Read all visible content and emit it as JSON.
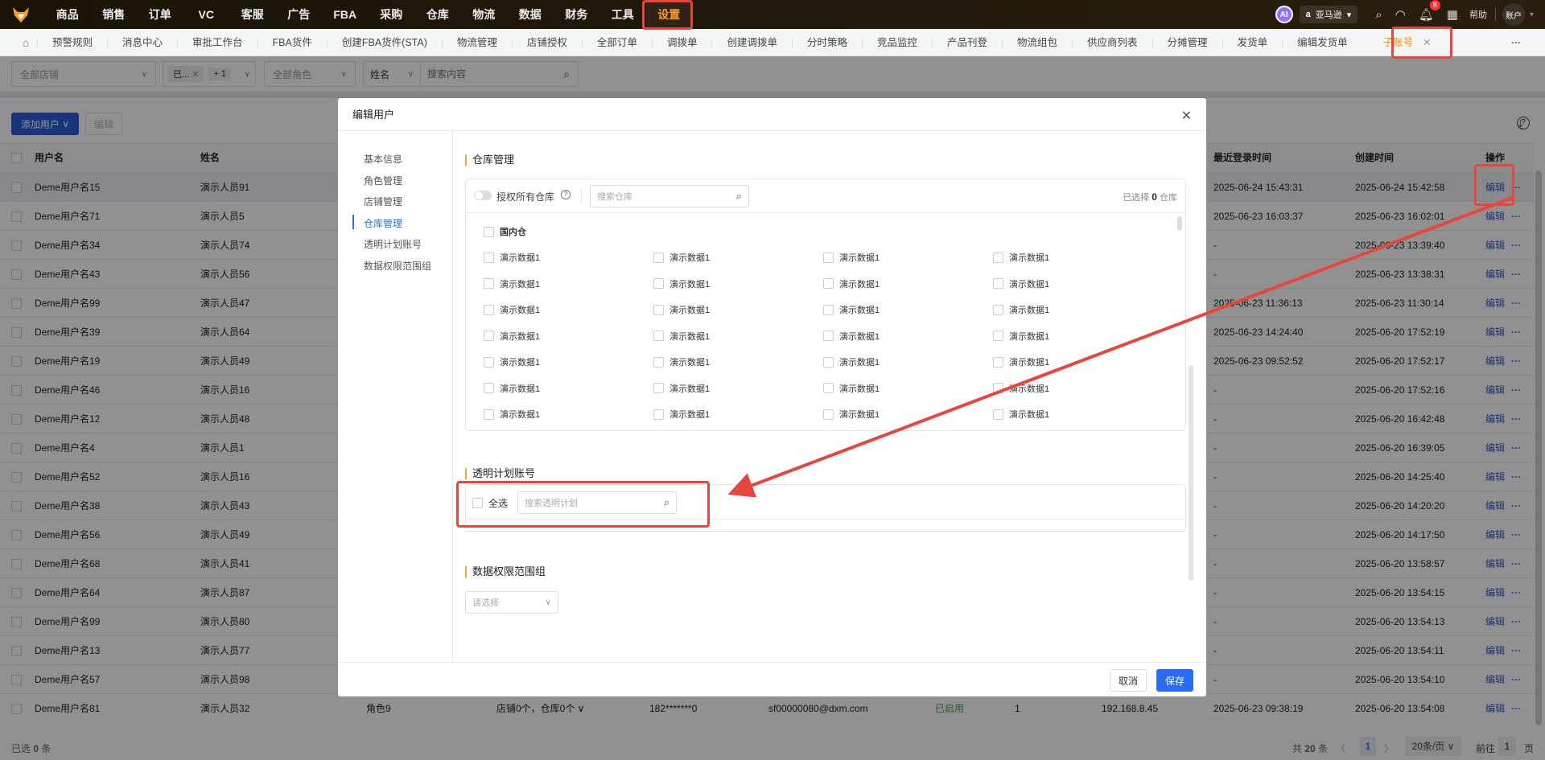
{
  "topnav": {
    "items": [
      "商品",
      "销售",
      "订单",
      "VC",
      "客服",
      "广告",
      "FBA",
      "采购",
      "仓库",
      "物流",
      "数据",
      "财务",
      "工具",
      "设置"
    ],
    "active": "设置",
    "ai": "AI",
    "platform": "亚马逊",
    "notifications": "8",
    "help": "帮助",
    "account": "账户"
  },
  "tabs": {
    "items": [
      "预警规则",
      "消息中心",
      "审批工作台",
      "FBA货件",
      "创建FBA货件(STA)",
      "物流管理",
      "店铺授权",
      "全部订单",
      "调拨单",
      "创建调拨单",
      "分时策略",
      "竞品监控",
      "产品刊登",
      "物流组包",
      "供应商列表",
      "分摊管理",
      "发货单",
      "编辑发货单"
    ],
    "active": "子账号",
    "more": "···"
  },
  "filters": {
    "store": "全部店铺",
    "status_chip": "已...",
    "status_more": "+ 1",
    "role": "全部角色",
    "field": "姓名",
    "search_placeholder": "搜索内容"
  },
  "toolbar": {
    "add_user": "添加用户",
    "edit": "编辑"
  },
  "table": {
    "headers": {
      "username": "用户名",
      "name": "姓名",
      "last_login": "最近登录时间",
      "created": "创建时间",
      "actions": "操作"
    },
    "edit_label": "编辑",
    "more_label": "···",
    "rows": [
      {
        "username": "Deme用户名15",
        "name": "演示人员91",
        "last_login": "2025-06-24 15:43:31",
        "created": "2025-06-24 15:42:58"
      },
      {
        "username": "Deme用户名71",
        "name": "演示人员5",
        "last_login": "2025-06-23 16:03:37",
        "created": "2025-06-23 16:02:01"
      },
      {
        "username": "Deme用户名34",
        "name": "演示人员74",
        "last_login": "-",
        "created": "2025-06-23 13:39:40"
      },
      {
        "username": "Deme用户名43",
        "name": "演示人员56",
        "last_login": "-",
        "created": "2025-06-23 13:38:31"
      },
      {
        "username": "Deme用户名99",
        "name": "演示人员47",
        "last_login": "2025-06-23 11:36:13",
        "created": "2025-06-23 11:30:14"
      },
      {
        "username": "Deme用户名39",
        "name": "演示人员64",
        "last_login": "2025-06-23 14:24:40",
        "created": "2025-06-20 17:52:19"
      },
      {
        "username": "Deme用户名19",
        "name": "演示人员49",
        "last_login": "2025-06-23 09:52:52",
        "created": "2025-06-20 17:52:17"
      },
      {
        "username": "Deme用户名46",
        "name": "演示人员16",
        "last_login": "-",
        "created": "2025-06-20 17:52:16"
      },
      {
        "username": "Deme用户名12",
        "name": "演示人员48",
        "last_login": "-",
        "created": "2025-06-20 16:42:48"
      },
      {
        "username": "Deme用户名4",
        "name": "演示人员1",
        "last_login": "-",
        "created": "2025-06-20 16:39:05"
      },
      {
        "username": "Deme用户名52",
        "name": "演示人员16",
        "last_login": "-",
        "created": "2025-06-20 14:25:40"
      },
      {
        "username": "Deme用户名38",
        "name": "演示人员43",
        "last_login": "-",
        "created": "2025-06-20 14:20:20"
      },
      {
        "username": "Deme用户名56",
        "name": "演示人员49",
        "last_login": "-",
        "created": "2025-06-20 14:17:50"
      },
      {
        "username": "Deme用户名68",
        "name": "演示人员41",
        "last_login": "-",
        "created": "2025-06-20 13:58:57"
      },
      {
        "username": "Deme用户名64",
        "name": "演示人员87",
        "last_login": "-",
        "created": "2025-06-20 13:54:15"
      },
      {
        "username": "Deme用户名99",
        "name": "演示人员80",
        "last_login": "-",
        "created": "2025-06-20 13:54:13"
      },
      {
        "username": "Deme用户名13",
        "name": "演示人员77",
        "last_login": "-",
        "created": "2025-06-20 13:54:11"
      },
      {
        "username": "Deme用户名57",
        "name": "演示人员98",
        "last_login": "-",
        "created": "2025-06-20 13:54:10"
      },
      {
        "username": "Deme用户名81",
        "name": "演示人员32",
        "role": "角色9",
        "scope": "店铺0个，仓库0个 ∨",
        "phone": "182*******0",
        "email": "sf00000080@dxm.com",
        "status": "已启用",
        "count": "1",
        "ip": "192.168.8.45",
        "last_login": "2025-06-23 09:38:19",
        "created": "2025-06-20 13:54:08"
      }
    ]
  },
  "footer": {
    "selected_prefix": "已选",
    "selected": "0",
    "selected_suffix": "条",
    "total_prefix": "共",
    "total": "20",
    "total_suffix": "条",
    "page": "1",
    "page_size": "20条/页",
    "goto": "前往",
    "goto_page": "1",
    "page_suffix": "页"
  },
  "modal": {
    "title": "编辑用户",
    "nav": [
      "基本信息",
      "角色管理",
      "店铺管理",
      "仓库管理",
      "透明计划账号",
      "数据权限范围组"
    ],
    "warehouse": {
      "title": "仓库管理",
      "authorize_all": "授权所有仓库",
      "search_placeholder": "搜索仓库",
      "selected_prefix": "已选择",
      "selected_count": "0",
      "selected_suffix": "仓库",
      "group": "国内仓",
      "items": [
        "演示数据1",
        "演示数据1",
        "演示数据1",
        "演示数据1",
        "演示数据1",
        "演示数据1",
        "演示数据1",
        "演示数据1",
        "演示数据1",
        "演示数据1",
        "演示数据1",
        "演示数据1",
        "演示数据1",
        "演示数据1",
        "演示数据1",
        "演示数据1",
        "演示数据1",
        "演示数据1",
        "演示数据1",
        "演示数据1",
        "演示数据1",
        "演示数据1",
        "演示数据1",
        "演示数据1",
        "演示数据1",
        "演示数据1",
        "演示数据1",
        "演示数据1"
      ]
    },
    "transparency": {
      "title": "透明计划账号",
      "select_all": "全选",
      "search_placeholder": "搜索透明计划"
    },
    "scope": {
      "title": "数据权限范围组",
      "placeholder": "请选择"
    },
    "cancel": "取消",
    "save": "保存"
  },
  "colors": {
    "accent": "#ff9a2e",
    "primary": "#2b6cf6",
    "annotation": "#e8453c"
  }
}
